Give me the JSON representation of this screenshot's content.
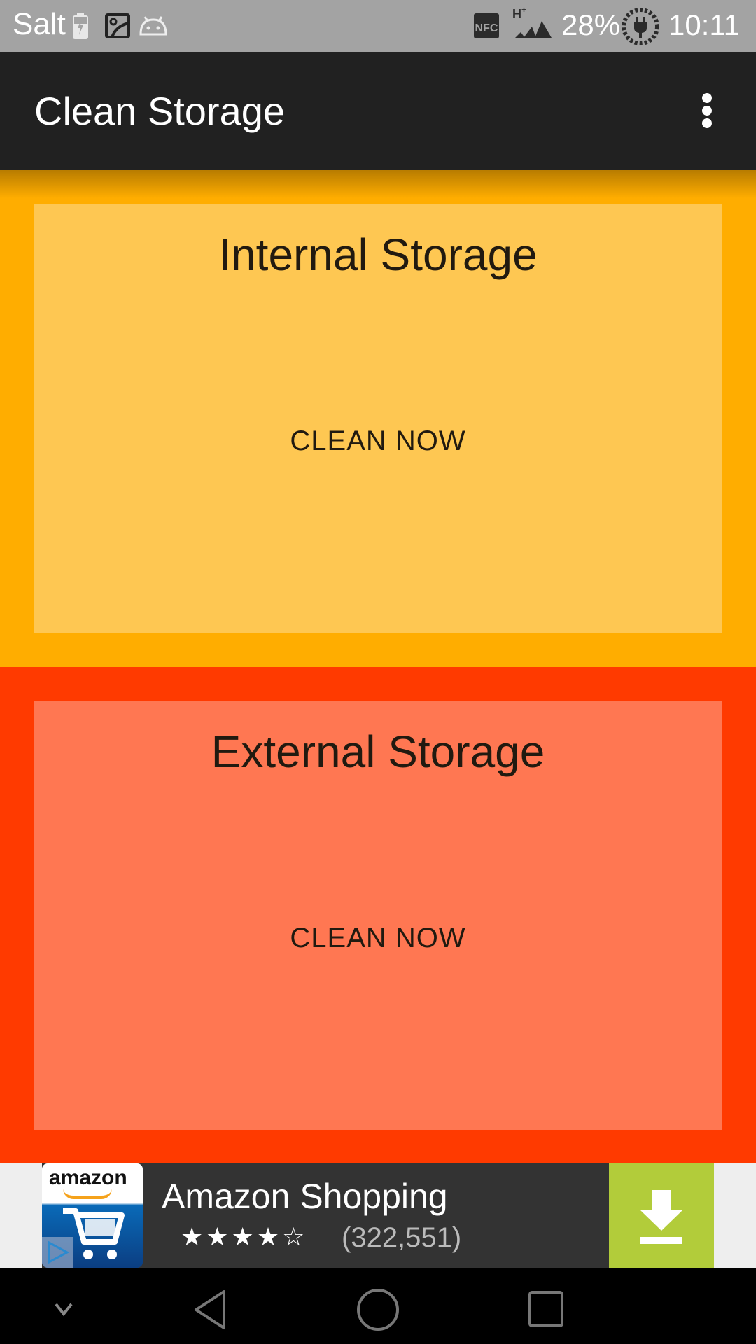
{
  "status_bar": {
    "carrier": "Salt",
    "left_icons": [
      "battery-charging-icon",
      "image-icon",
      "android-icon"
    ],
    "right_icons": [
      "nfc-icon",
      "signal-hplus-icon",
      "charging-plug-icon"
    ],
    "battery_percent": "28%",
    "time": "10:11"
  },
  "app_bar": {
    "title": "Clean Storage",
    "menu_icon": "more-vert-icon"
  },
  "sections": [
    {
      "title": "Internal Storage",
      "button_label": "CLEAN NOW",
      "color": "#ffad00",
      "card_color": "#fec752"
    },
    {
      "title": "External Storage",
      "button_label": "CLEAN NOW",
      "color": "#ff3a00",
      "card_color": "#ff7752"
    }
  ],
  "ad": {
    "logo_text": "amazon",
    "app_name": "Amazon Shopping",
    "rating_stars": "★★★★☆",
    "rating": 4,
    "rating_max": 5,
    "review_count": "(322,551)",
    "action_icon": "download-icon",
    "accent_color": "#b2cc3a"
  },
  "nav_bar": {
    "items": [
      "hide-keyboard-icon",
      "back-icon",
      "home-icon",
      "recents-icon"
    ]
  }
}
